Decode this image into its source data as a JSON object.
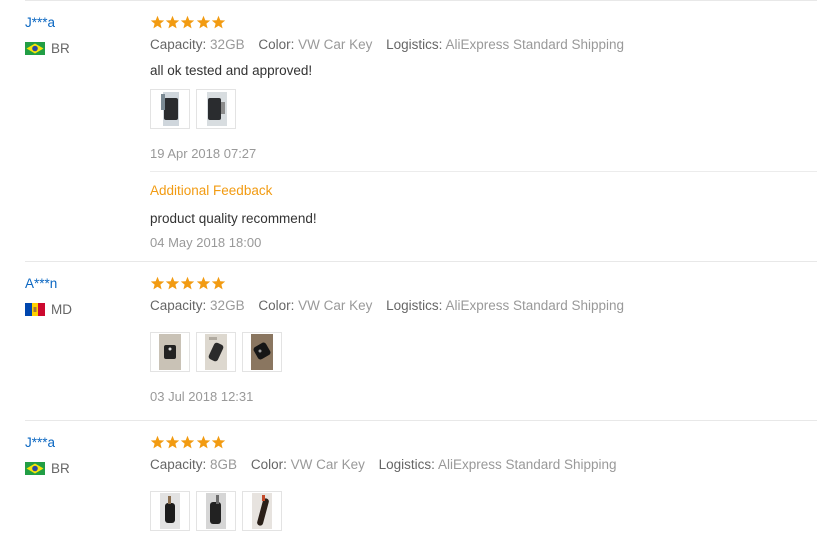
{
  "reviews": [
    {
      "user": "J***a",
      "country": "BR",
      "flag": "brazil-flag-icon",
      "rating": 5,
      "attrs": {
        "capacity_label": "Capacity:",
        "capacity": "32GB",
        "color_label": "Color:",
        "color": "VW Car Key",
        "logistics_label": "Logistics:",
        "logistics": "AliExpress Standard Shipping"
      },
      "text": "all ok tested and approved!",
      "photos": 2,
      "date": "19 Apr 2018 07:27",
      "additional": {
        "title": "Additional Feedback",
        "text": "product quality recommend!",
        "date": "04 May 2018 18:00"
      }
    },
    {
      "user": "A***n",
      "country": "MD",
      "flag": "moldova-flag-icon",
      "rating": 5,
      "attrs": {
        "capacity_label": "Capacity:",
        "capacity": "32GB",
        "color_label": "Color:",
        "color": "VW Car Key",
        "logistics_label": "Logistics:",
        "logistics": "AliExpress Standard Shipping"
      },
      "photos": 3,
      "date": "03 Jul 2018 12:31"
    },
    {
      "user": "J***a",
      "country": "BR",
      "flag": "brazil-flag-icon",
      "rating": 5,
      "attrs": {
        "capacity_label": "Capacity:",
        "capacity": "8GB",
        "color_label": "Color:",
        "color": "VW Car Key",
        "logistics_label": "Logistics:",
        "logistics": "AliExpress Standard Shipping"
      },
      "photos": 3
    }
  ],
  "colors": {
    "star": "#f29b12",
    "username": "#0b67c2",
    "additional_title": "#f29b12"
  }
}
